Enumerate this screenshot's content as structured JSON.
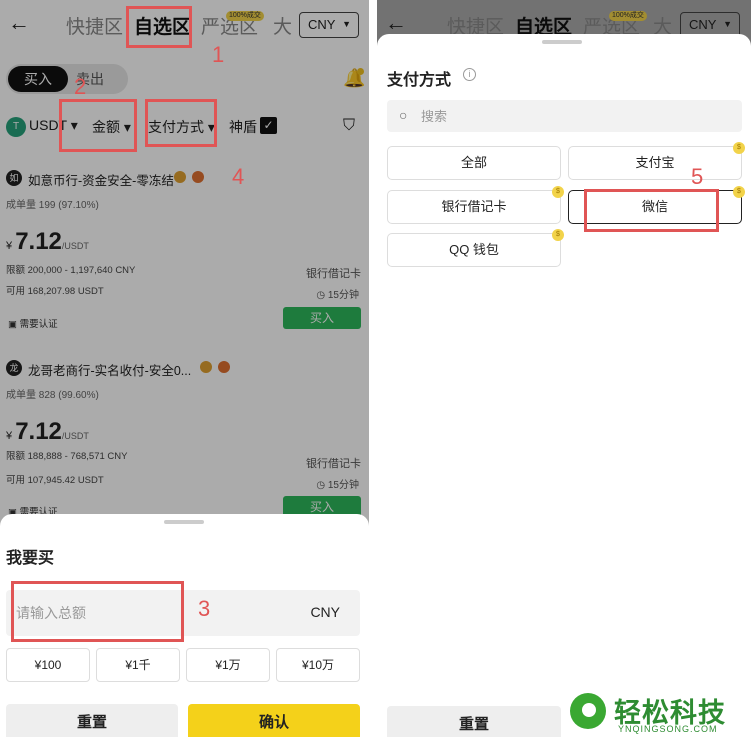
{
  "left": {
    "header": {
      "tabs": [
        "快捷区",
        "自选区",
        "严选区",
        "大"
      ],
      "badge": "100%成交",
      "currency": "CNY"
    },
    "side_tabs": {
      "buy": "买入",
      "sell": "卖出"
    },
    "filters": {
      "coin": "USDT",
      "amount": "金额",
      "payment": "支付方式",
      "shield": "神盾"
    },
    "merchants": [
      {
        "avatar": "如",
        "name": "如意币行-资金安全-零冻结",
        "stats": "成单量 199 (97.10%)",
        "price": "7.12",
        "unit": "/USDT",
        "limit": "限额 200,000 - 1,197,640 CNY",
        "available": "可用 168,207.98 USDT",
        "payment": "银行借记卡",
        "time": "15分钟",
        "buy": "买入",
        "verify": "需要认证"
      },
      {
        "avatar": "龙",
        "name": "龙哥老商行-实名收付-安全0...",
        "stats": "成单量 828 (99.60%)",
        "price": "7.12",
        "unit": "/USDT",
        "limit": "限额 188,888 - 768,571 CNY",
        "available": "可用 107,945.42 USDT",
        "payment": "银行借记卡",
        "time": "15分钟",
        "buy": "买入",
        "verify": "需要认证"
      }
    ],
    "sheet": {
      "title": "我要买",
      "input_placeholder": "请输入总额",
      "currency": "CNY",
      "quick": [
        "¥100",
        "¥1千",
        "¥1万",
        "¥10万"
      ],
      "reset": "重置",
      "confirm": "确认"
    },
    "annotations": [
      "1",
      "2",
      "3",
      "4"
    ]
  },
  "right": {
    "header": {
      "tabs": [
        "快捷区",
        "自选区",
        "严选区",
        "大"
      ],
      "badge": "100%成交",
      "currency": "CNY"
    },
    "title": "支付方式",
    "search_placeholder": "搜索",
    "options": [
      "全部",
      "支付宝",
      "银行借记卡",
      "微信",
      "QQ 钱包"
    ],
    "reset": "重置",
    "annotation": "5"
  },
  "watermark": {
    "text": "轻松科技",
    "sub": "YNQINGSONG.COM"
  },
  "colors": {
    "accent_yellow": "#f4d11a",
    "buy_green": "#2eb85c",
    "annotation_red": "#e05555"
  }
}
